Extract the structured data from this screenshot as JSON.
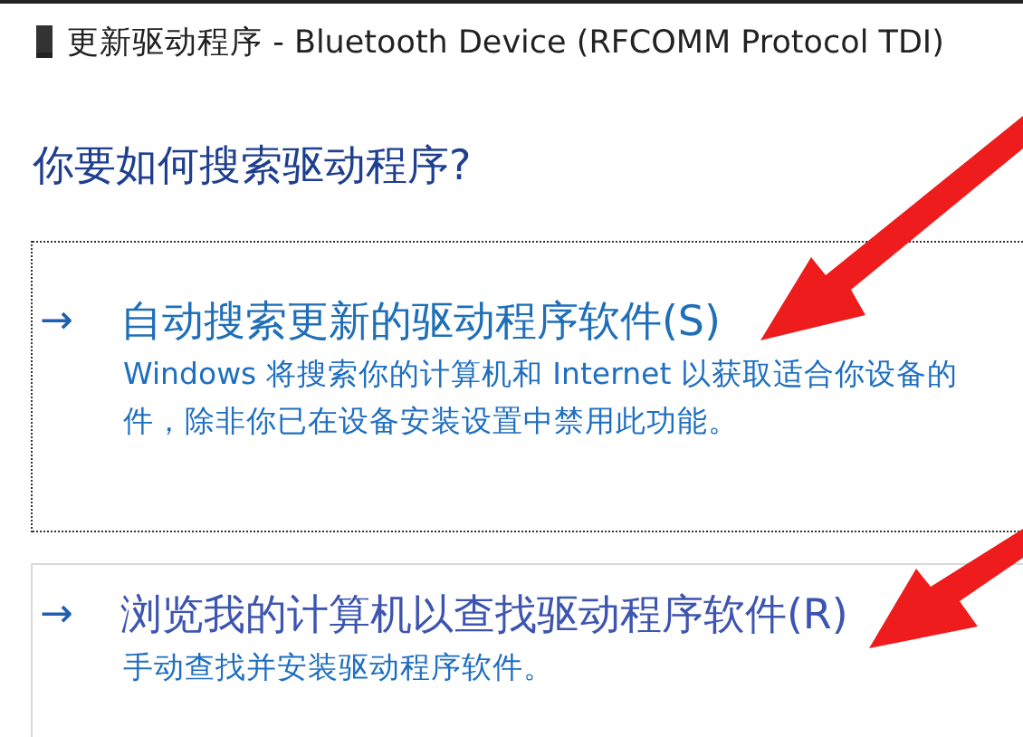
{
  "window": {
    "title": "更新驱动程序 - Bluetooth Device (RFCOMM Protocol TDI)"
  },
  "heading": "你要如何搜索驱动程序?",
  "options": [
    {
      "arrow": "→",
      "title": "自动搜索更新的驱动程序软件(S)",
      "description_lines": [
        "Windows 将搜索你的计算机和 Internet 以获取适合你设备的",
        "件，除非你已在设备安装设置中禁用此功能。"
      ],
      "focused": true
    },
    {
      "arrow": "→",
      "title": "浏览我的计算机以查找驱动程序软件(R)",
      "description_lines": [
        "手动查找并安装驱动程序软件。"
      ],
      "focused": false
    }
  ]
}
